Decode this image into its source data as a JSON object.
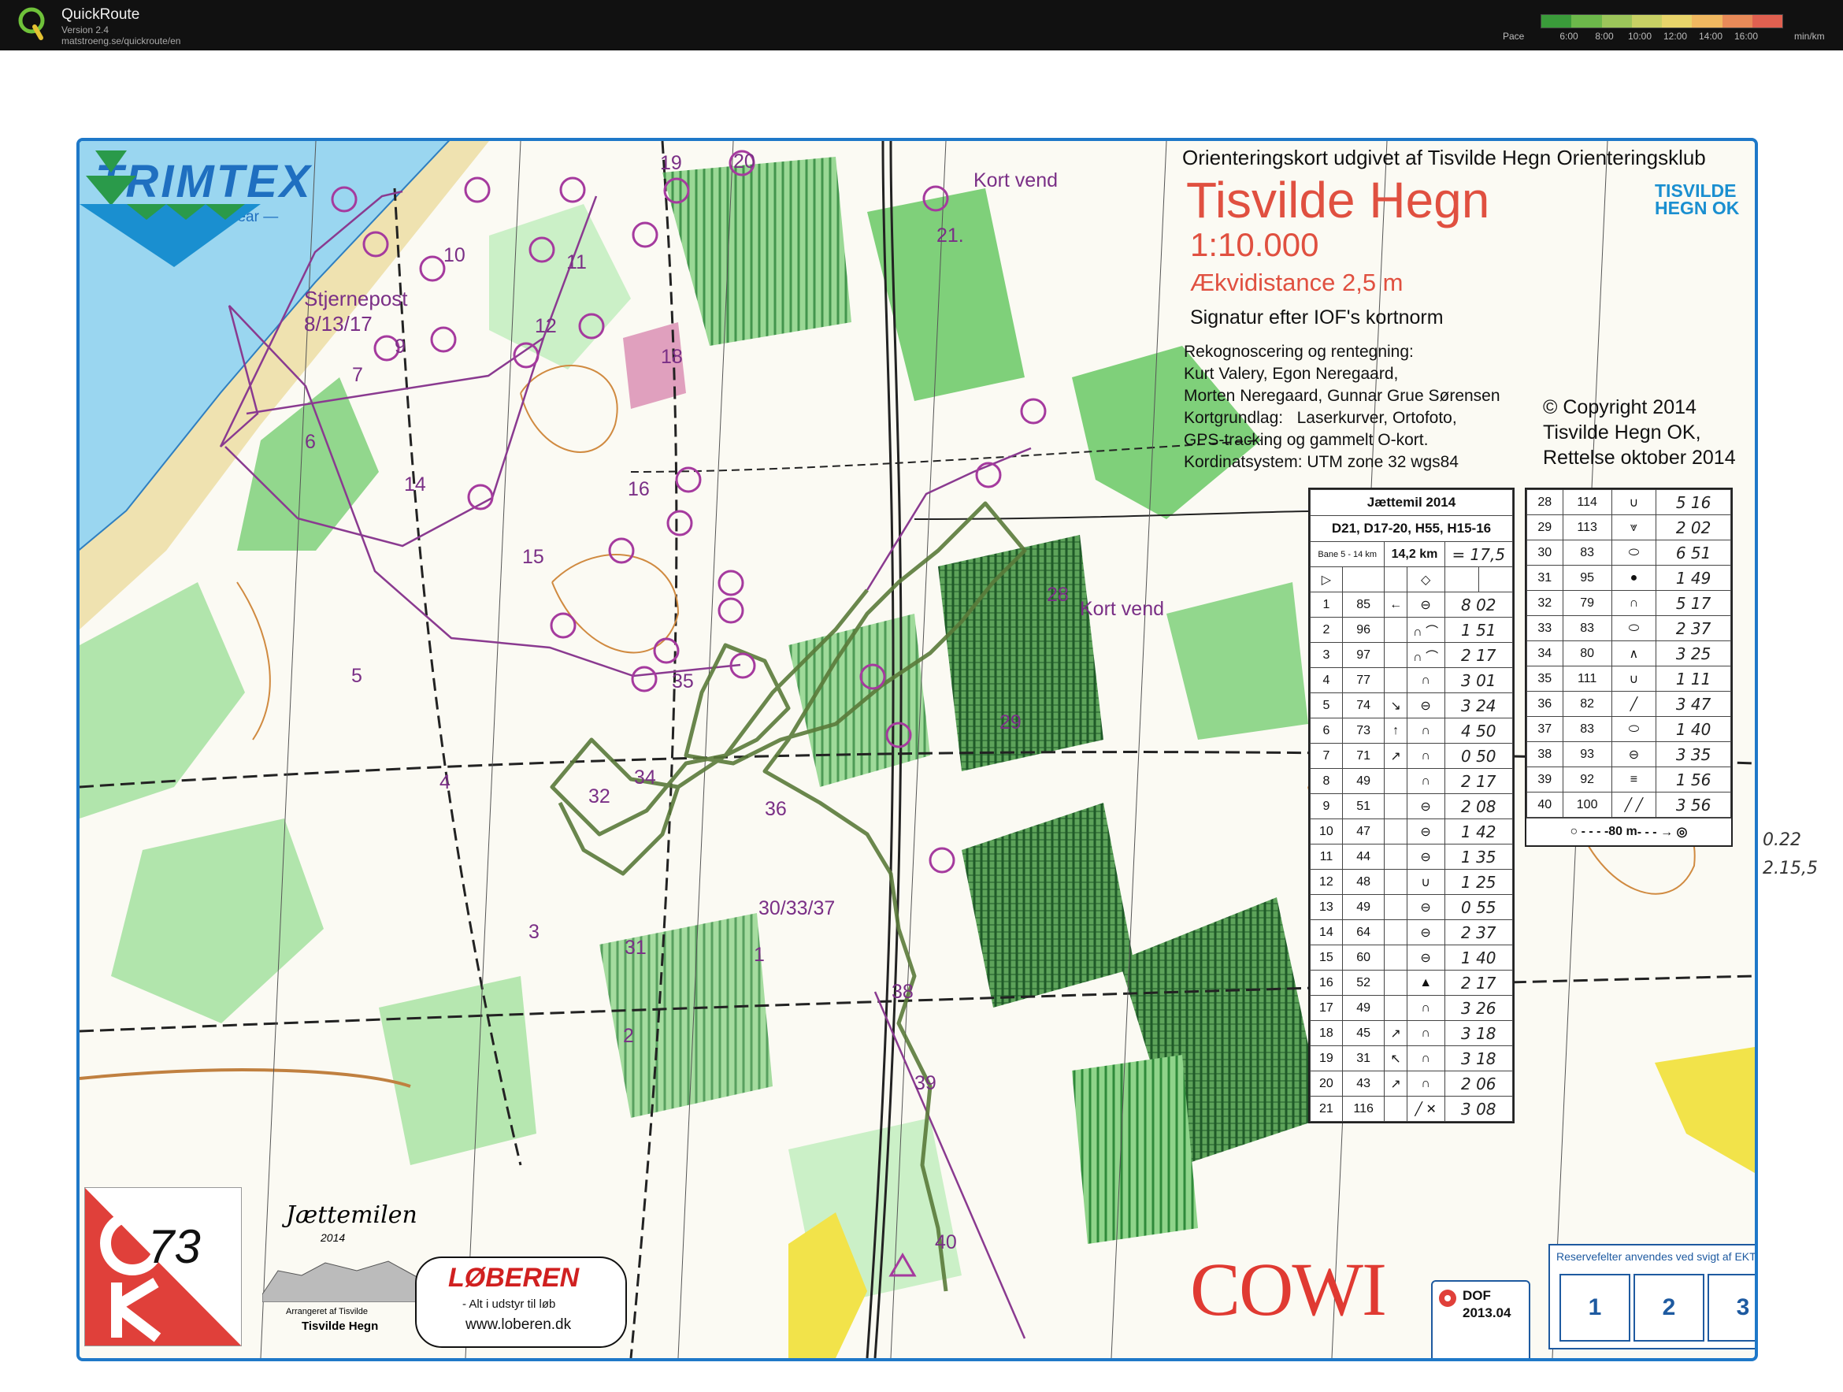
{
  "app": {
    "title": "QuickRoute",
    "version": "Version 2.4",
    "url": "matstroeng.se/quickroute/en",
    "pace_label": "Pace",
    "pace_ticks": [
      "6:00",
      "8:00",
      "10:00",
      "12:00",
      "14:00",
      "16:00"
    ],
    "pace_unit": "min/km",
    "pace_colors": [
      "#3a9b3a",
      "#6cb84a",
      "#9cc55a",
      "#c8d064",
      "#e8d46a",
      "#f0b860",
      "#e88a58",
      "#e06050"
    ]
  },
  "map": {
    "publisher_line": "Orienteringskort udgivet af Tisvilde Hegn Orienteringsklub",
    "name": "Tisvilde Hegn",
    "scale": "1:10.000",
    "equidistance": "Ækvidistance 2,5 m",
    "symbols": "Signatur efter IOF's kortnorm",
    "credits": "Rekognoscering og rentegning:\nKurt Valery, Egon Neregaard,\nMorten Neregaard, Gunnar Grue Sørensen\nKortgrundlag:   Laserkurver, Ortofoto,\nGPS-tracking og gammelt O-kort.\nKordinatsystem: UTM zone 32 wgs84",
    "copyright": "© Copyright 2014\nTisvilde Hegn OK,\nRettelse oktober 2014",
    "club_logo_text": "TISVILDE\nHEGN OK",
    "sponsor_trimtex": "TRIMTEX",
    "sponsor_trimtex_sub": "— Custom sportswear —",
    "star_post": "Stjernepost\n8/13/17",
    "kort_vend_1": "Kort vend",
    "kort_vend_2": "Kort vend",
    "cowi": "COWI",
    "dof_label": "DOF",
    "dof_code": "2013.04",
    "reserve_title": "Reservefelter anvendes ved svigt af EKT",
    "reserve_boxes": [
      "1",
      "2",
      "3"
    ],
    "ok73": "73",
    "jaettemilen_title": "Jættemilen",
    "jaettemilen_year": "2014",
    "jaettemilen_sub1": "Arrangeret af Tisvilde",
    "jaettemilen_sub2": "Tisvilde Hegn",
    "loberen_title": "LØBEREN",
    "loberen_tag": "- Alt i udstyr til løb",
    "loberen_url": "www.loberen.dk",
    "margin_note_1": "0.22",
    "margin_note_2": "2.15,5",
    "distance_bar": "80 m"
  },
  "controls": [
    {
      "n": "1"
    },
    {
      "n": "2"
    },
    {
      "n": "3"
    },
    {
      "n": "4"
    },
    {
      "n": "5"
    },
    {
      "n": "6"
    },
    {
      "n": "7"
    },
    {
      "n": "9"
    },
    {
      "n": "10"
    },
    {
      "n": "11"
    },
    {
      "n": "12"
    },
    {
      "n": "14"
    },
    {
      "n": "15"
    },
    {
      "n": "16"
    },
    {
      "n": "18"
    },
    {
      "n": "19"
    },
    {
      "n": "20"
    },
    {
      "n": "21."
    },
    {
      "n": "28"
    },
    {
      "n": "29"
    },
    {
      "n": "31"
    },
    {
      "n": "32"
    },
    {
      "n": "34"
    },
    {
      "n": "35"
    },
    {
      "n": "36"
    },
    {
      "n": "30/33/37"
    },
    {
      "n": "38"
    },
    {
      "n": "39"
    },
    {
      "n": "40"
    }
  ],
  "description_sheet": {
    "event": "Jættemil 2014",
    "classes": "D21, D17-20, H55, H15-16",
    "course": "Bane 5 - 14 km",
    "length": "14,2 km",
    "handwritten_total": "= 17,5",
    "rows_left": [
      {
        "no": "1",
        "code": "85",
        "dir": "←",
        "feat": "⊖",
        "split": "8 02"
      },
      {
        "no": "2",
        "code": "96",
        "dir": "",
        "feat": "∩ ⌒",
        "split": "1 51"
      },
      {
        "no": "3",
        "code": "97",
        "dir": "",
        "feat": "∩ ⌒",
        "split": "2 17"
      },
      {
        "no": "4",
        "code": "77",
        "dir": "",
        "feat": "∩",
        "split": "3 01"
      },
      {
        "no": "5",
        "code": "74",
        "dir": "↘",
        "feat": "⊖",
        "split": "3 24"
      },
      {
        "no": "6",
        "code": "73",
        "dir": "↑",
        "feat": "∩",
        "split": "4 50"
      },
      {
        "no": "7",
        "code": "71",
        "dir": "↗",
        "feat": "∩",
        "split": "0 50"
      },
      {
        "no": "8",
        "code": "49",
        "dir": "",
        "feat": "∩",
        "split": "2 17"
      },
      {
        "no": "9",
        "code": "51",
        "dir": "",
        "feat": "⊖",
        "split": "2 08"
      },
      {
        "no": "10",
        "code": "47",
        "dir": "",
        "feat": "⊖",
        "split": "1 42"
      },
      {
        "no": "11",
        "code": "44",
        "dir": "",
        "feat": "⊖",
        "split": "1 35"
      },
      {
        "no": "12",
        "code": "48",
        "dir": "",
        "feat": "∪",
        "split": "1 25"
      },
      {
        "no": "13",
        "code": "49",
        "dir": "",
        "feat": "⊖",
        "split": "0 55"
      },
      {
        "no": "14",
        "code": "64",
        "dir": "",
        "feat": "⊖",
        "split": "2 37"
      },
      {
        "no": "15",
        "code": "60",
        "dir": "",
        "feat": "⊖",
        "split": "1 40"
      },
      {
        "no": "16",
        "code": "52",
        "dir": "",
        "feat": "▲",
        "split": "2 17"
      },
      {
        "no": "17",
        "code": "49",
        "dir": "",
        "feat": "∩",
        "split": "3 26"
      },
      {
        "no": "18",
        "code": "45",
        "dir": "↗",
        "feat": "∩",
        "split": "3 18"
      },
      {
        "no": "19",
        "code": "31",
        "dir": "↖",
        "feat": "∩",
        "split": "3 18"
      },
      {
        "no": "20",
        "code": "43",
        "dir": "↗",
        "feat": "∩",
        "split": "2 06"
      },
      {
        "no": "21",
        "code": "116",
        "dir": "",
        "feat": "╱ ✕",
        "split": "3 08"
      }
    ],
    "rows_right": [
      {
        "no": "28",
        "code": "114",
        "feat": "∪",
        "split": "5 16"
      },
      {
        "no": "29",
        "code": "113",
        "feat": "⩔",
        "split": "2 02"
      },
      {
        "no": "30",
        "code": "83",
        "feat": "⬭",
        "split": "6 51"
      },
      {
        "no": "31",
        "code": "95",
        "feat": "●",
        "split": "1 49"
      },
      {
        "no": "32",
        "code": "79",
        "feat": "∩",
        "split": "5 17"
      },
      {
        "no": "33",
        "code": "83",
        "feat": "⬭",
        "split": "2 37"
      },
      {
        "no": "34",
        "code": "80",
        "feat": "∧",
        "split": "3 25"
      },
      {
        "no": "35",
        "code": "111",
        "feat": "∪",
        "split": "1 11"
      },
      {
        "no": "36",
        "code": "82",
        "feat": "╱",
        "split": "3 47"
      },
      {
        "no": "37",
        "code": "83",
        "feat": "⬭",
        "split": "1 40"
      },
      {
        "no": "38",
        "code": "93",
        "feat": "⊖",
        "split": "3 35"
      },
      {
        "no": "39",
        "code": "92",
        "feat": "≡",
        "split": "1 56"
      },
      {
        "no": "40",
        "code": "100",
        "feat": "╱ ╱",
        "split": "3 56"
      }
    ]
  }
}
